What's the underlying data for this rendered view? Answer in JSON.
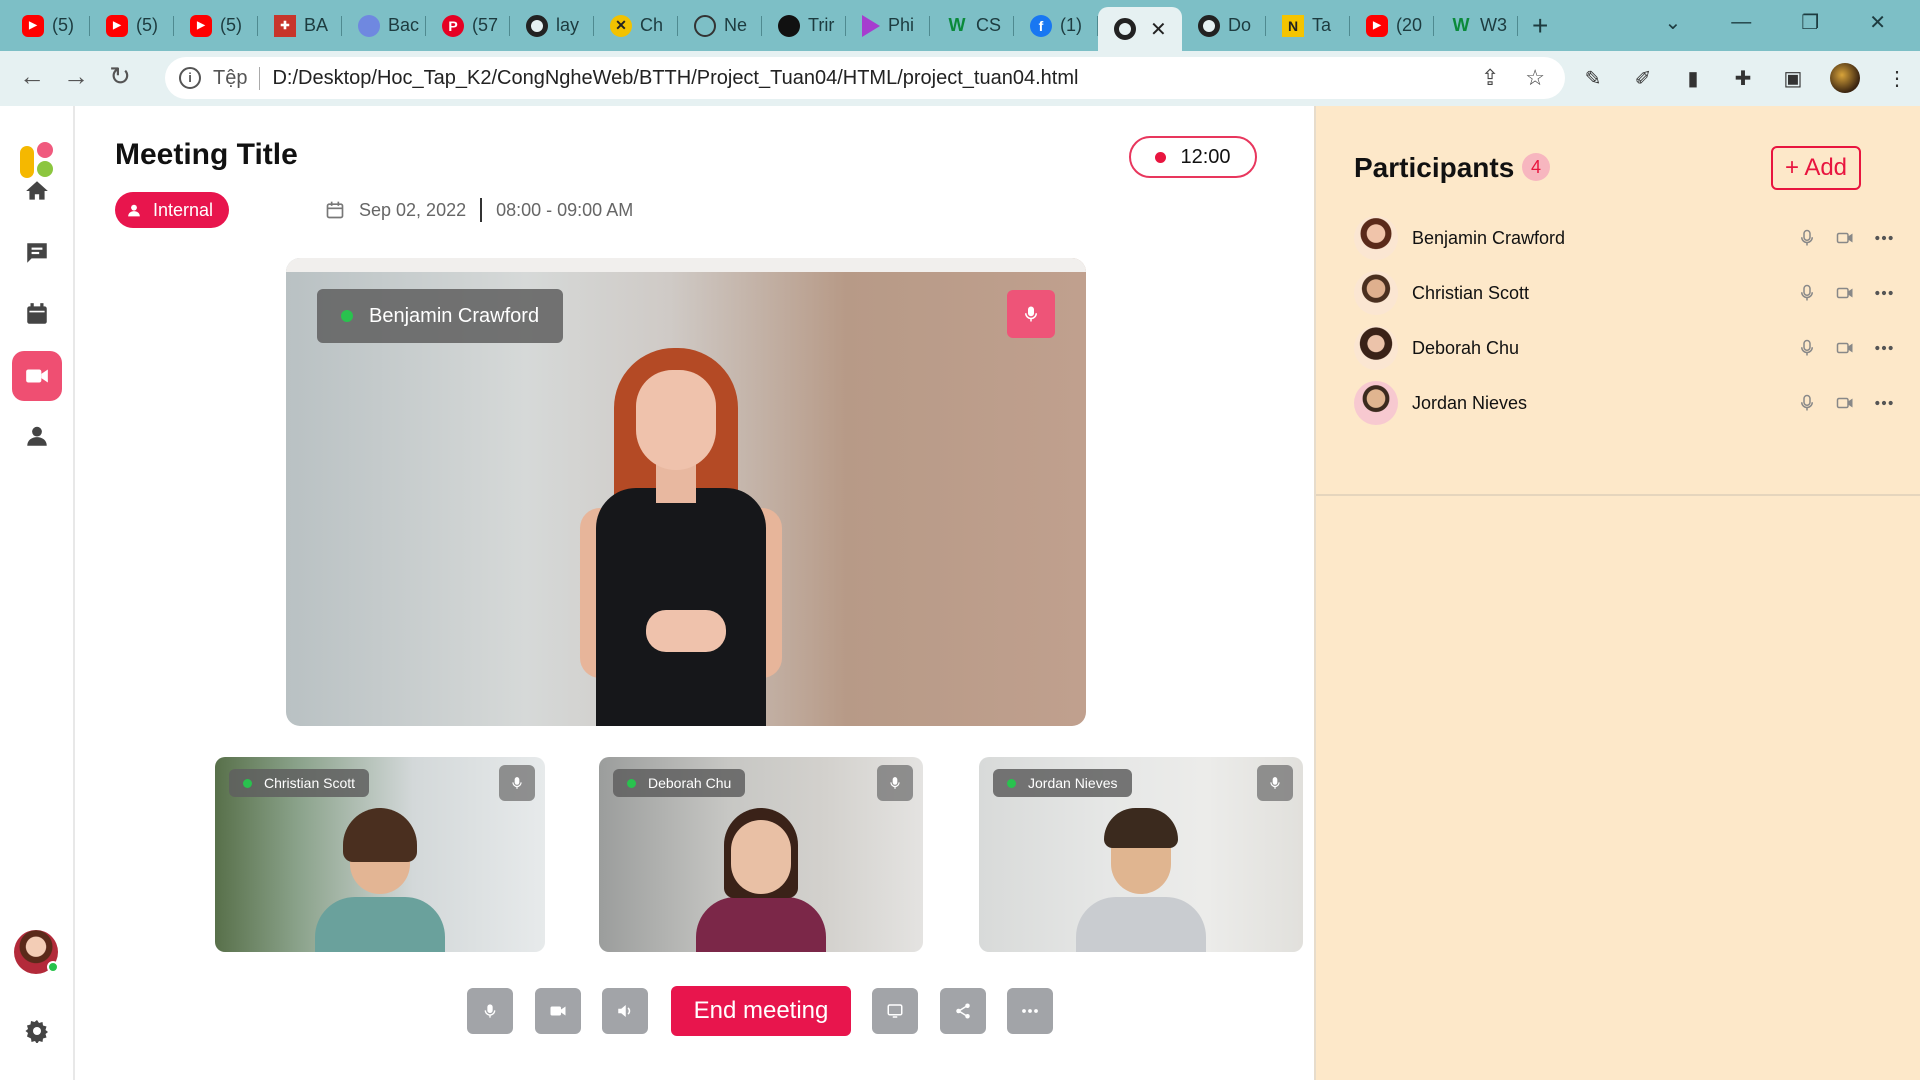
{
  "browser": {
    "tabs": [
      {
        "icon": "youtube-icon",
        "label": "(5)"
      },
      {
        "icon": "youtube-icon",
        "label": "(5)"
      },
      {
        "icon": "youtube-icon",
        "label": "(5)"
      },
      {
        "icon": "university-icon",
        "label": "BA"
      },
      {
        "icon": "bug-icon",
        "label": "Bac"
      },
      {
        "icon": "pinterest-icon",
        "label": "(57"
      },
      {
        "icon": "globe-icon",
        "label": "lay"
      },
      {
        "icon": "chat-icon",
        "label": "Ch"
      },
      {
        "icon": "openai-icon",
        "label": "Ne"
      },
      {
        "icon": "github-icon",
        "label": "Trir"
      },
      {
        "icon": "play-icon",
        "label": "Phi"
      },
      {
        "icon": "w-icon",
        "label": "CS"
      },
      {
        "icon": "facebook-icon",
        "label": "(1)"
      },
      {
        "icon": "globe-icon",
        "label": "",
        "active": true
      },
      {
        "icon": "globe-icon",
        "label": "Do"
      },
      {
        "icon": "notion-icon",
        "label": "Ta"
      },
      {
        "icon": "youtube-icon",
        "label": "(20"
      },
      {
        "icon": "w-icon",
        "label": "W3"
      }
    ],
    "address": {
      "scheme": "Tệp",
      "url": "D:/Desktop/Hoc_Tap_K2/CongNgheWeb/BTTH/Project_Tuan04/HTML/project_tuan04.html"
    }
  },
  "meeting": {
    "title": "Meeting Title",
    "timer": "12:00",
    "badge": "Internal",
    "date": "Sep 02, 2022",
    "time": "08:00 - 09:00 AM",
    "main_speaker": "Benjamin Crawford",
    "thumbnails": [
      {
        "name": "Christian Scott"
      },
      {
        "name": "Deborah Chu"
      },
      {
        "name": "Jordan Nieves"
      }
    ],
    "end_label": "End meeting"
  },
  "participants": {
    "title": "Participants",
    "count": "4",
    "add_label": "+ Add",
    "list": [
      {
        "name": "Benjamin Crawford"
      },
      {
        "name": "Christian Scott"
      },
      {
        "name": "Deborah Chu"
      },
      {
        "name": "Jordan Nieves"
      }
    ]
  },
  "colors": {
    "accent": "#e8154d",
    "panel_bg": "#fde8c9",
    "live": "#29c24e",
    "browser_frame": "#7dbfc6"
  }
}
